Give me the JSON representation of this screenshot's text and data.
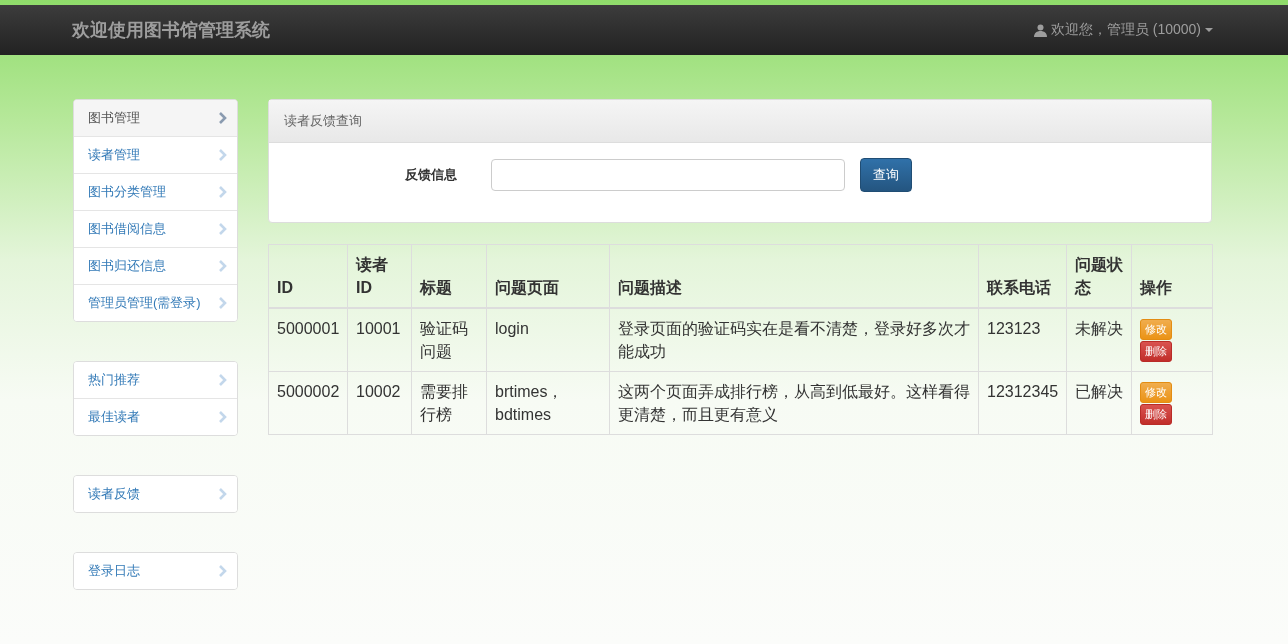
{
  "navbar": {
    "title": "欢迎使用图书馆管理系统",
    "user_menu": "欢迎您，管理员 (10000)"
  },
  "sidebar": {
    "groups": [
      {
        "items": [
          {
            "label": "图书管理",
            "selected": true
          },
          {
            "label": "读者管理",
            "selected": false
          },
          {
            "label": "图书分类管理",
            "selected": false
          },
          {
            "label": "图书借阅信息",
            "selected": false
          },
          {
            "label": "图书归还信息",
            "selected": false
          },
          {
            "label": "管理员管理(需登录)",
            "selected": false
          }
        ]
      },
      {
        "items": [
          {
            "label": "热门推荐",
            "selected": false
          },
          {
            "label": "最佳读者",
            "selected": false
          }
        ]
      },
      {
        "items": [
          {
            "label": "读者反馈",
            "selected": false
          }
        ]
      },
      {
        "items": [
          {
            "label": "登录日志",
            "selected": false
          }
        ]
      }
    ]
  },
  "search_panel": {
    "heading": "读者反馈查询",
    "field_label": "反馈信息",
    "button": "查询"
  },
  "table": {
    "columns": [
      "ID",
      "读者ID",
      "标题",
      "问题页面",
      "问题描述",
      "联系电话",
      "问题状态",
      "操作"
    ],
    "rows": [
      {
        "cells": [
          "5000001",
          "10001",
          "验证码问题",
          "login",
          "登录页面的验证码实在是看不清楚，登录好多次才能成功",
          "123123",
          "未解决"
        ],
        "actions": [
          "修改",
          "删除"
        ]
      },
      {
        "cells": [
          "5000002",
          "10002",
          "需要排行榜",
          "brtimes，bdtimes",
          "这两个页面弄成排行榜，从高到低最好。这样看得更清楚，而且更有意义",
          "12312345",
          "已解决"
        ],
        "actions": [
          "修改",
          "删除"
        ]
      }
    ]
  }
}
